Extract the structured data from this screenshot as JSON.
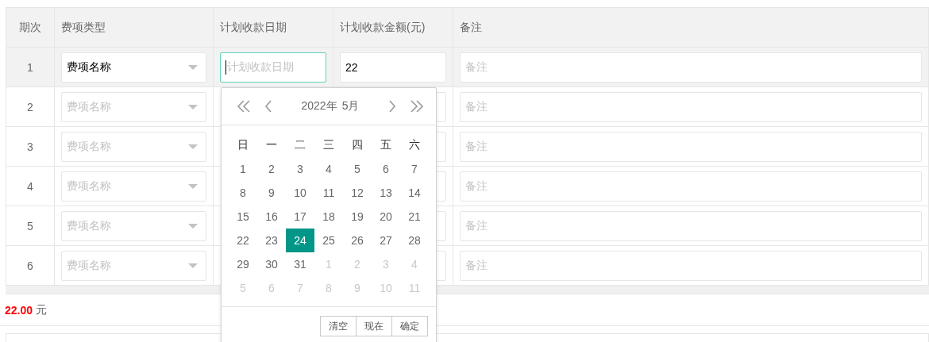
{
  "table": {
    "columns": [
      "期次",
      "费项类型",
      "计划收款日期",
      "计划收款金额(元)",
      "备注"
    ],
    "rows": [
      {
        "period": "1",
        "selected": true,
        "fee": {
          "value": "费项名称"
        },
        "date": {
          "placeholder": "计划收款日期",
          "focused": true
        },
        "amount": {
          "value": "22"
        },
        "remark": {
          "placeholder": "备注"
        }
      },
      {
        "period": "2",
        "selected": false,
        "fee": {
          "placeholder": "费项名称"
        },
        "remark": {
          "placeholder": "备注"
        }
      },
      {
        "period": "3",
        "selected": false,
        "fee": {
          "placeholder": "费项名称"
        },
        "remark": {
          "placeholder": "备注"
        }
      },
      {
        "period": "4",
        "selected": false,
        "fee": {
          "placeholder": "费项名称"
        },
        "remark": {
          "placeholder": "备注"
        }
      },
      {
        "period": "5",
        "selected": false,
        "fee": {
          "placeholder": "费项名称"
        },
        "remark": {
          "placeholder": "备注"
        }
      },
      {
        "period": "6",
        "selected": false,
        "fee": {
          "placeholder": "费项名称"
        },
        "remark": {
          "placeholder": "备注"
        }
      }
    ]
  },
  "date_picker": {
    "year": "2022年",
    "month": "5月",
    "weekdays": [
      "日",
      "一",
      "二",
      "三",
      "四",
      "五",
      "六"
    ],
    "days": [
      {
        "label": "1",
        "muted": false,
        "selected": false
      },
      {
        "label": "2",
        "muted": false,
        "selected": false
      },
      {
        "label": "3",
        "muted": false,
        "selected": false
      },
      {
        "label": "4",
        "muted": false,
        "selected": false
      },
      {
        "label": "5",
        "muted": false,
        "selected": false
      },
      {
        "label": "6",
        "muted": false,
        "selected": false
      },
      {
        "label": "7",
        "muted": false,
        "selected": false
      },
      {
        "label": "8",
        "muted": false,
        "selected": false
      },
      {
        "label": "9",
        "muted": false,
        "selected": false
      },
      {
        "label": "10",
        "muted": false,
        "selected": false
      },
      {
        "label": "11",
        "muted": false,
        "selected": false
      },
      {
        "label": "12",
        "muted": false,
        "selected": false
      },
      {
        "label": "13",
        "muted": false,
        "selected": false
      },
      {
        "label": "14",
        "muted": false,
        "selected": false
      },
      {
        "label": "15",
        "muted": false,
        "selected": false
      },
      {
        "label": "16",
        "muted": false,
        "selected": false
      },
      {
        "label": "17",
        "muted": false,
        "selected": false
      },
      {
        "label": "18",
        "muted": false,
        "selected": false
      },
      {
        "label": "19",
        "muted": false,
        "selected": false
      },
      {
        "label": "20",
        "muted": false,
        "selected": false
      },
      {
        "label": "21",
        "muted": false,
        "selected": false
      },
      {
        "label": "22",
        "muted": false,
        "selected": false
      },
      {
        "label": "23",
        "muted": false,
        "selected": false
      },
      {
        "label": "24",
        "muted": false,
        "selected": true
      },
      {
        "label": "25",
        "muted": false,
        "selected": false
      },
      {
        "label": "26",
        "muted": false,
        "selected": false
      },
      {
        "label": "27",
        "muted": false,
        "selected": false
      },
      {
        "label": "28",
        "muted": false,
        "selected": false
      },
      {
        "label": "29",
        "muted": false,
        "selected": false
      },
      {
        "label": "30",
        "muted": false,
        "selected": false
      },
      {
        "label": "31",
        "muted": false,
        "selected": false
      },
      {
        "label": "1",
        "muted": true,
        "selected": false
      },
      {
        "label": "2",
        "muted": true,
        "selected": false
      },
      {
        "label": "3",
        "muted": true,
        "selected": false
      },
      {
        "label": "4",
        "muted": true,
        "selected": false
      },
      {
        "label": "5",
        "muted": true,
        "selected": false
      },
      {
        "label": "6",
        "muted": true,
        "selected": false
      },
      {
        "label": "7",
        "muted": true,
        "selected": false
      },
      {
        "label": "8",
        "muted": true,
        "selected": false
      },
      {
        "label": "9",
        "muted": true,
        "selected": false
      },
      {
        "label": "10",
        "muted": true,
        "selected": false
      },
      {
        "label": "11",
        "muted": true,
        "selected": false
      }
    ],
    "buttons": [
      "清空",
      "现在",
      "确定"
    ]
  },
  "total": {
    "amount": "22.00",
    "unit": "元"
  }
}
